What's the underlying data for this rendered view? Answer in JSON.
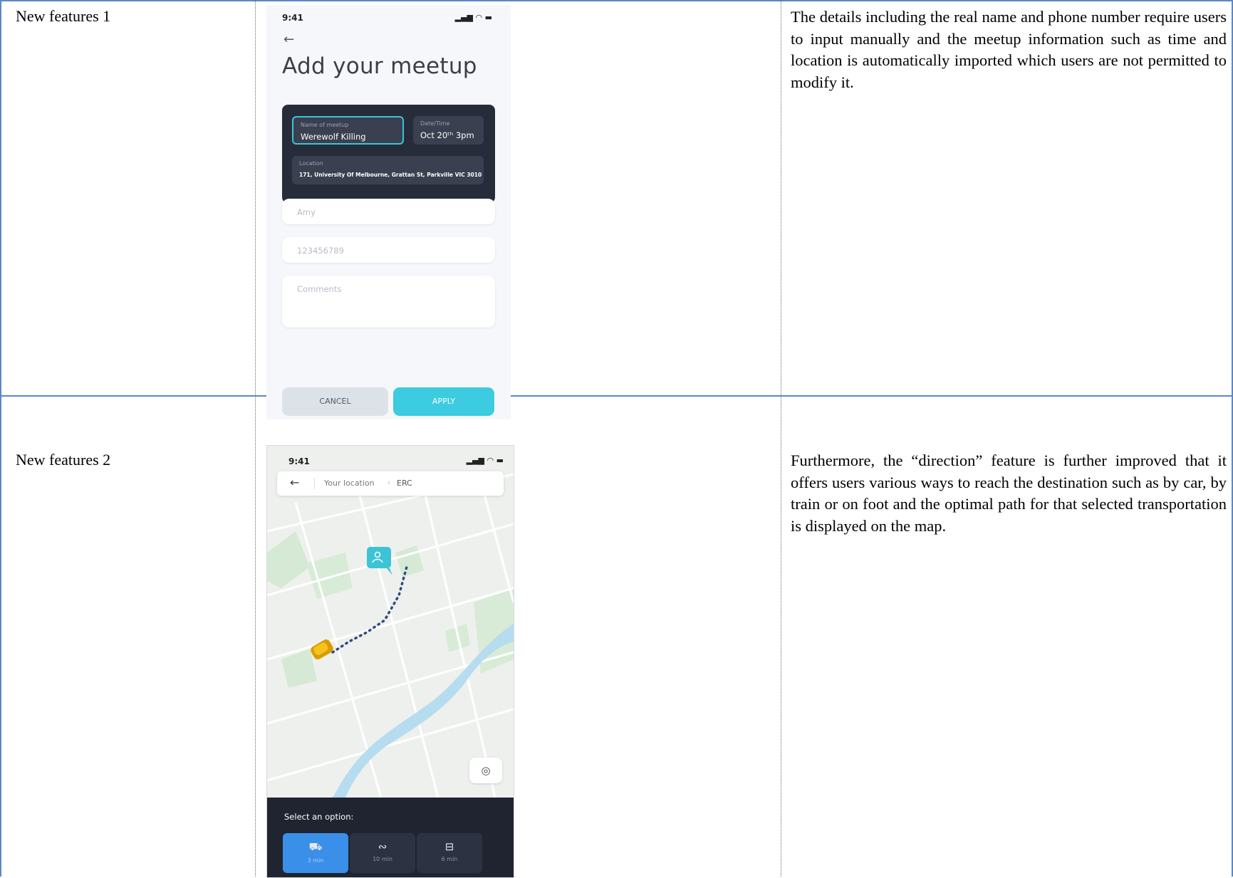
{
  "rows": [
    {
      "label": "New features 1",
      "description": "The details including the real name and phone number require users to input manually and the meetup information such as time and location is automatically imported which users are not permitted to modify it."
    },
    {
      "label": "New features 2",
      "description": "Furthermore, the “direction” feature is further improved that it offers users various ways to reach the destination such as by car, by train or on foot and the optimal path for that selected transportation is displayed on the map."
    }
  ],
  "phone1": {
    "time": "9:41",
    "back_icon": "arrow-left-icon",
    "title": "Add your meetup",
    "meetup_name_caption": "Name of meetup",
    "meetup_name_value": "Werewolf Killing",
    "datetime_caption": "Date/Time",
    "datetime_value": "Oct 20ᵗʰ 3pm",
    "location_caption": "Location",
    "location_value": "171, University Of Melbourne, Grattan St, Parkville VIC 3010",
    "name_placeholder": "Amy",
    "phone_placeholder": "123456789",
    "comments_placeholder": "Comments",
    "cancel_label": "CANCEL",
    "apply_label": "APPLY",
    "accent_color": "#3ccbe0",
    "card_color": "#272c3a"
  },
  "phone2": {
    "time": "9:41",
    "back_icon": "arrow-left-icon",
    "from": "Your location",
    "to": "ERC",
    "sheet_title": "Select an option:",
    "options": [
      {
        "icon": "car-icon",
        "time": "3 min",
        "selected": true
      },
      {
        "icon": "walk-icon",
        "time": "10 min",
        "selected": false
      },
      {
        "icon": "train-icon",
        "time": "6 min",
        "selected": false
      }
    ],
    "selected_color": "#3a8fe8",
    "route_color": "#2f4c82"
  }
}
